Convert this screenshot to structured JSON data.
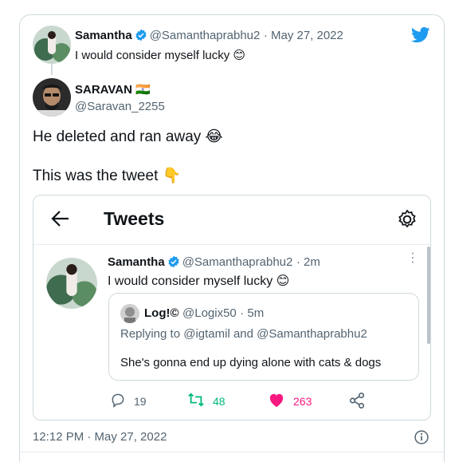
{
  "original_tweet": {
    "name": "Samantha",
    "handle": "@Samanthaprabhu2",
    "date": "· May 27, 2022",
    "text": "I would consider myself lucky 😊"
  },
  "reply": {
    "name": "SARAVAN 🇮🇳",
    "handle": "@Saravan_2255",
    "line1": "He deleted and ran away 😂",
    "line2": "This was the tweet 👇"
  },
  "embed": {
    "title": "Tweets",
    "tweet": {
      "name": "Samantha",
      "handle": "@Samanthaprabhu2",
      "time": "· 2m",
      "text": "I would consider myself lucky 😊"
    },
    "quoted": {
      "name": "Log!©",
      "handle": "@Logix50",
      "time": "· 5m",
      "replying": "Replying to @igtamil and @Samanthaprabhu2",
      "text": "She's gonna end up dying alone with cats & dogs"
    },
    "actions": {
      "replies": "19",
      "retweets": "48",
      "likes": "263"
    }
  },
  "footer": {
    "timestamp": "12:12 PM · May 27, 2022"
  },
  "colors": {
    "twitter_blue": "#1d9bf0",
    "retweet_green": "#00ba7c",
    "like_pink": "#f91880",
    "muted": "#536471"
  },
  "icons": [
    "twitter-bird-icon",
    "verified-badge-icon",
    "back-arrow-icon",
    "gear-icon",
    "reply-icon",
    "retweet-icon",
    "heart-icon",
    "share-icon",
    "info-icon",
    "more-icon"
  ]
}
